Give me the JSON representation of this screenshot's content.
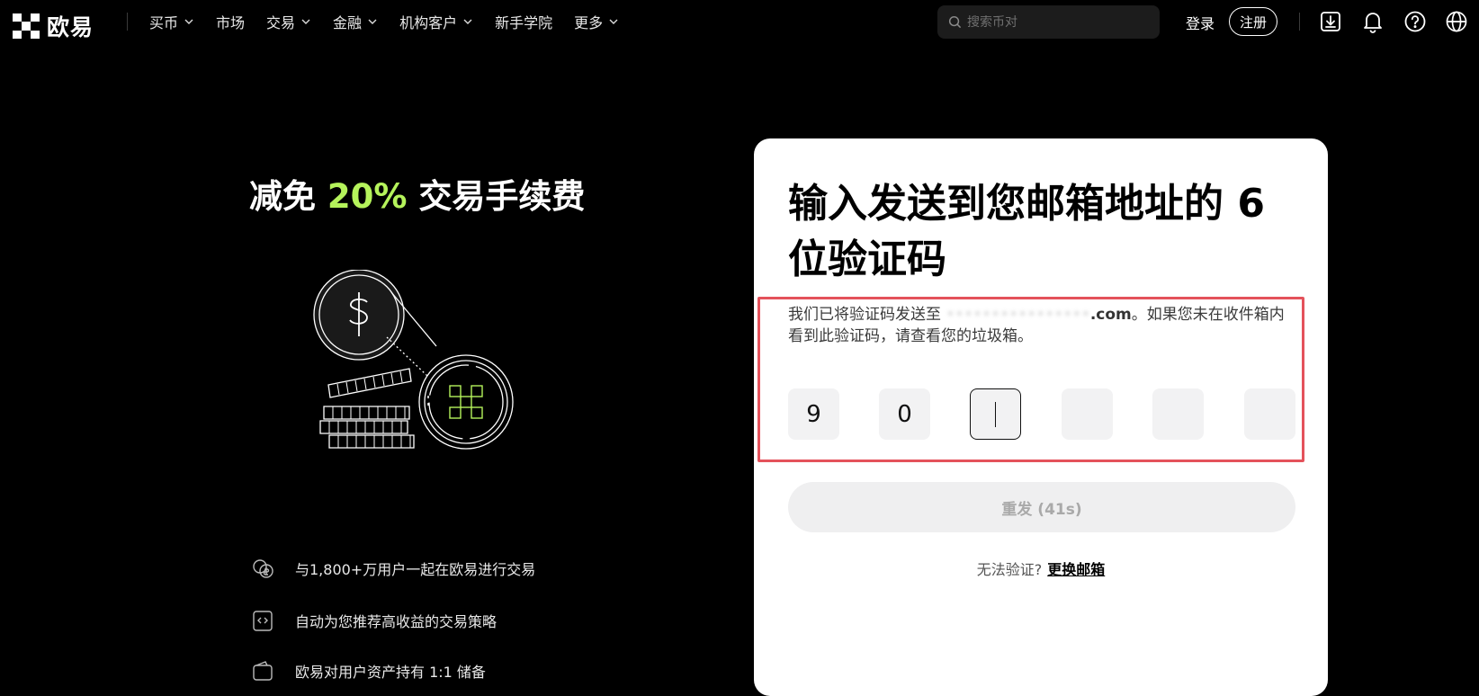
{
  "nav": {
    "logo_text": "欧易",
    "items": [
      {
        "label": "买币",
        "dropdown": true
      },
      {
        "label": "市场",
        "dropdown": false
      },
      {
        "label": "交易",
        "dropdown": true
      },
      {
        "label": "金融",
        "dropdown": true
      },
      {
        "label": "机构客户",
        "dropdown": true
      },
      {
        "label": "新手学院",
        "dropdown": false
      },
      {
        "label": "更多",
        "dropdown": true
      }
    ],
    "search_placeholder": "搜索币对",
    "login_label": "登录",
    "register_label": "注册",
    "icons": [
      "download-icon",
      "bell-icon",
      "help-icon",
      "globe-icon"
    ]
  },
  "promo": {
    "title_prefix": "减免 ",
    "title_highlight": "20%",
    "title_suffix": " 交易手续费",
    "features": [
      {
        "icon": "users-coins-icon",
        "text": "与1,800+万用户一起在欧易进行交易"
      },
      {
        "icon": "strategy-icon",
        "text": "自动为您推荐高收益的交易策略"
      },
      {
        "icon": "wallet-icon",
        "text": "欧易对用户资产持有 1:1 储备"
      }
    ]
  },
  "card": {
    "title": "输入发送到您邮箱地址的 6 位验证码",
    "desc_prefix": "我们已将验证码发送至 ",
    "email_masked": "••••••••••••••••",
    "email_suffix": ".com",
    "desc_suffix": "。如果您未在收件箱内看到此验证码，请查看您的垃圾箱。",
    "code_digits": [
      "9",
      "0",
      "",
      "",
      "",
      ""
    ],
    "active_index": 2,
    "resend_label": "重发 (41s)",
    "cant_verify_label": "无法验证?",
    "change_email_label": "更换邮箱"
  },
  "colors": {
    "accent_green": "#b5f35b",
    "highlight_red": "#e4525b",
    "background": "#000000"
  }
}
